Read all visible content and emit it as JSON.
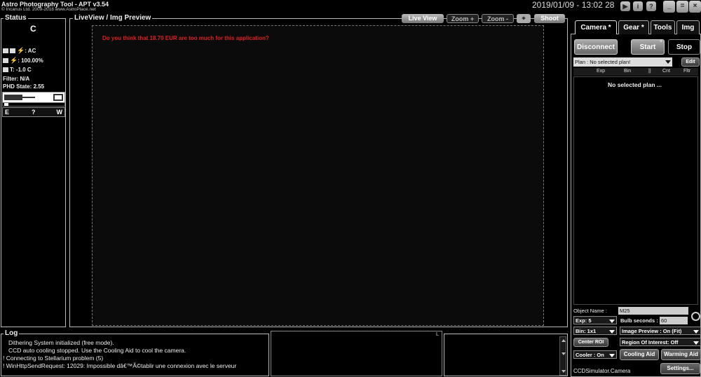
{
  "app": {
    "title": "Astro Photography Tool  -  APT v3.54",
    "copyright": "© Incanus Ltd. 2009-2018  www.AstroPlace.net",
    "datetime": "2019/01/09 - 13:02 28"
  },
  "window_buttons": [
    "▶",
    "i",
    "?",
    "_",
    "=",
    "×"
  ],
  "status": {
    "label": "Status",
    "compass": "C",
    "power": ": AC",
    "battery": ": 100.00%",
    "temp_label": "T:",
    "temp": "-1.0 C",
    "filter": "Filter: N/A",
    "phd": "PHD State: 2.55",
    "dir_e": "E",
    "dir_q": "?",
    "dir_w": "W"
  },
  "liveview": {
    "label": "LiveView / Img Preview",
    "buttons": [
      "Live View",
      "Zoom +",
      "Zoom -",
      "Shoot"
    ],
    "message": "Do you think that 18.70 EUR are too much for this application?"
  },
  "log": {
    "label": "Log",
    "lines": [
      "Dithering System initialized (free mode).",
      "CCD auto cooling stopped. Use the Cooling Aid to cool the camera.",
      "! Connecting to Stellarium problem (5)",
      "! WinHttpSendRequest: 12029: Impossible dâ€™Ã©tablir une connexion avec le serveur"
    ],
    "indicator": "L"
  },
  "right": {
    "tabs": [
      "Camera *",
      "Gear *",
      "Tools",
      "Img"
    ],
    "disconnect": "Disconnect",
    "start": "Start",
    "stop": "Stop",
    "plan": "Plan : No selected plan!",
    "edit": "Edit",
    "columns": [
      "Exp",
      "Bin",
      "||",
      "Cnt",
      "Fltr"
    ],
    "no_plan": "No selected plan ...",
    "object_name_label": "Object Name :",
    "object_name": "M25",
    "exp": "Exp: 5",
    "bulb_label": "Bulb seconds :",
    "bulb": "60",
    "bin": "Bin: 1x1",
    "preview": "Image Preview : On (Fit)",
    "center_roi": "Center ROI",
    "roi": "Region Of Interest: Off",
    "cooler": "Cooler : On",
    "cooling_aid": "Cooling Aid",
    "warming_aid": "Warming Aid",
    "camera": "CCDSimulator.Camera",
    "settings": "Settings..."
  },
  "colors": {
    "accent_red": "#e02020",
    "button_gray": "#8a8a8a"
  }
}
